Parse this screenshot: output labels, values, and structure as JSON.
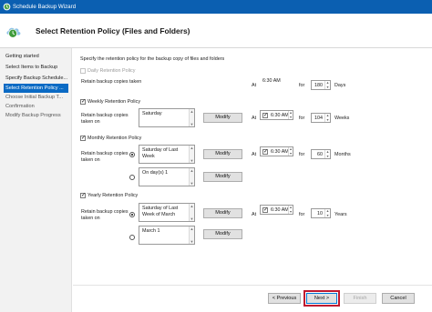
{
  "window": {
    "title": "Schedule Backup Wizard"
  },
  "header": {
    "title": "Select Retention Policy (Files and Folders)"
  },
  "sidebar": {
    "items": [
      {
        "label": "Getting started",
        "state": "done"
      },
      {
        "label": "Select Items to Backup",
        "state": "done"
      },
      {
        "label": "Specify Backup Schedule...",
        "state": "done"
      },
      {
        "label": "Select Retention Policy ...",
        "state": "active"
      },
      {
        "label": "Choose Initial Backup T...",
        "state": "upcoming"
      },
      {
        "label": "Confirmation",
        "state": "upcoming"
      },
      {
        "label": "Modify Backup Progress",
        "state": "upcoming"
      }
    ]
  },
  "main": {
    "intro": "Specify the retention policy for the backup copy of files and folders",
    "daily": {
      "label": "Daily Retention Policy",
      "checked": false,
      "enabled": false,
      "retain_label": "Retain backup copies taken",
      "at_label": "At",
      "time": "6:30 AM",
      "for_label": "for",
      "count": "180",
      "unit": "Days"
    },
    "weekly": {
      "label": "Weekly Retention Policy",
      "checked": true,
      "retain_label": "Retain backup copies taken on",
      "day": "Saturday",
      "modify_label": "Modify",
      "at_label": "At",
      "time": "6:30 AM",
      "time_checked": true,
      "for_label": "for",
      "count": "104",
      "unit": "Weeks"
    },
    "monthly": {
      "label": "Monthly Retention Policy",
      "checked": true,
      "retain_label": "Retain backup copies taken on",
      "option1": {
        "text": "Saturday of Last Week",
        "selected": true
      },
      "option2": {
        "text": "On day(s) 1",
        "selected": false
      },
      "modify_label": "Modify",
      "at_label": "At",
      "time": "6:30 AM",
      "time_checked": true,
      "for_label": "for",
      "count": "60",
      "unit": "Months"
    },
    "yearly": {
      "label": "Yearly Retention Policy",
      "checked": true,
      "retain_label": "Retain backup copies taken on",
      "option1": {
        "text": "Saturday of Last Week of March",
        "selected": true
      },
      "option2": {
        "text": "March 1",
        "selected": false
      },
      "modify_label": "Modify",
      "at_label": "At",
      "time": "6:30 AM",
      "time_checked": true,
      "for_label": "for",
      "count": "10",
      "unit": "Years"
    }
  },
  "footer": {
    "previous_label": "< Previous",
    "next_label": "Next >",
    "finish_label": "Finish",
    "cancel_label": "Cancel"
  },
  "colors": {
    "titlebar": "#0b5fb1",
    "active_step": "#0a6ac4",
    "highlight": "#c0182f"
  },
  "icons": {
    "title": "backup-wizard-icon",
    "header": "backup-clock-icon"
  }
}
